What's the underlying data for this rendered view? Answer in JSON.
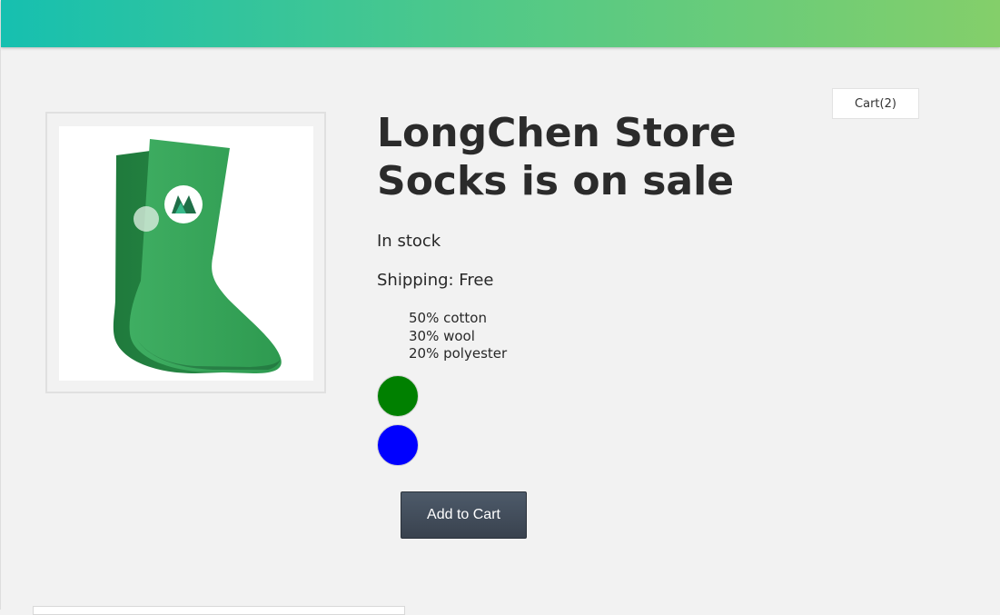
{
  "header": {
    "gradient_start": "#16c0b0",
    "gradient_end": "#84cf6a"
  },
  "cart": {
    "label": "Cart(2)"
  },
  "product": {
    "image_icon": "socks-image",
    "title_line1": "LongChen Store",
    "title_line2": "Socks is on sale",
    "stock": "In stock",
    "shipping": "Shipping: Free",
    "details": [
      "50% cotton",
      "30% wool",
      "20% polyester"
    ],
    "variants": [
      {
        "color": "#008000"
      },
      {
        "color": "#0000ff"
      }
    ],
    "add_to_cart_label": "Add to Cart"
  }
}
